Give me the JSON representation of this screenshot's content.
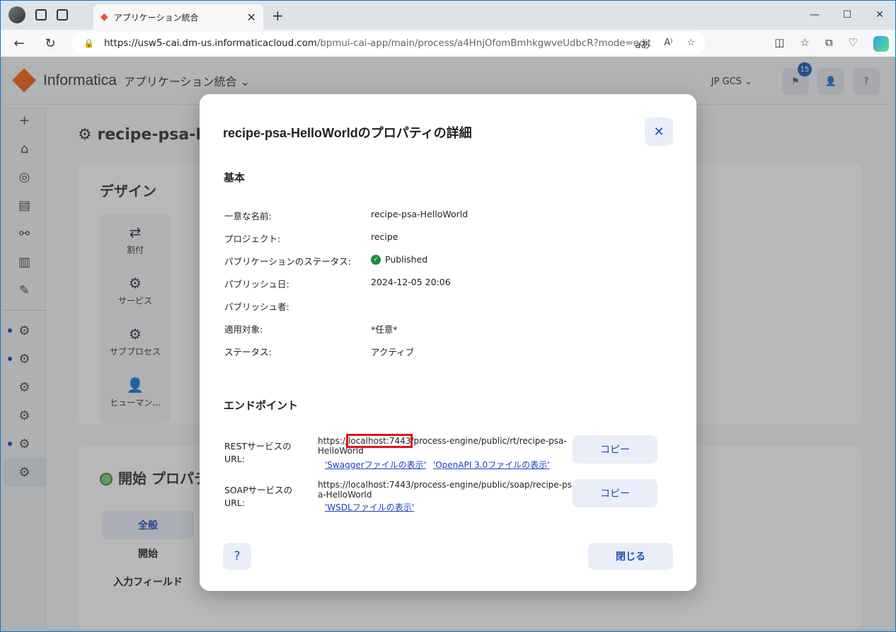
{
  "browser": {
    "tab_title": "アプリケーション統合",
    "url_host": "https://usw5-cai.dm-us.informaticacloud.com",
    "url_path": "/bpmui-cai-app/main/process/a4HnjOfomBmhkgwveUdbcR?mode=edit"
  },
  "app": {
    "logo_text": "Informatica",
    "app_name": "アプリケーション統合",
    "org": "JP GCS",
    "notification_count": "15",
    "page_title": "recipe-psa-H",
    "design_title": "デザイン",
    "palette": [
      "割付",
      "サービス",
      "サブプロセス",
      "ヒューマン..."
    ],
    "props_title": "開始 プロパティ",
    "props_tabs": [
      "全般",
      "開始",
      "入力フィールド"
    ]
  },
  "dialog": {
    "title": "recipe-psa-HelloWorldのプロパティの詳細",
    "basic_heading": "基本",
    "fields": [
      {
        "label": "一意な名前:",
        "value": "recipe-psa-HelloWorld"
      },
      {
        "label": "プロジェクト:",
        "value": "recipe"
      },
      {
        "label": "パブリケーションのステータス:",
        "value": "Published"
      },
      {
        "label": "パブリッシュ日:",
        "value": "2024-12-05 20:06"
      },
      {
        "label": "パブリッシュ者:",
        "value": ""
      },
      {
        "label": "適用対象:",
        "value": "*任意*"
      },
      {
        "label": "ステータス:",
        "value": "アクティブ"
      }
    ],
    "endpoint_heading": "エンドポイント",
    "rest": {
      "label": "RESTサービスの URL:",
      "url_prefix": "https://",
      "url_highlight": "localhost:7443",
      "url_suffix": "/process-engine/public/rt/recipe-psa-HelloWorld",
      "link1": "'Swaggerファイルの表示'",
      "link2": "'OpenAPI 3.0ファイルの表示'",
      "copy": "コピー"
    },
    "soap": {
      "label": "SOAPサービスの URL:",
      "url": "https://localhost:7443/process-engine/public/soap/recipe-psa-HelloWorld",
      "link1": "'WSDLファイルの表示'",
      "copy": "コピー"
    },
    "help": "?",
    "close_label": "閉じる"
  },
  "colors": {
    "accent": "#1f4fb5",
    "button_bg": "#e9eef8",
    "highlight": "#e0131d",
    "success": "#1e8e3e"
  }
}
